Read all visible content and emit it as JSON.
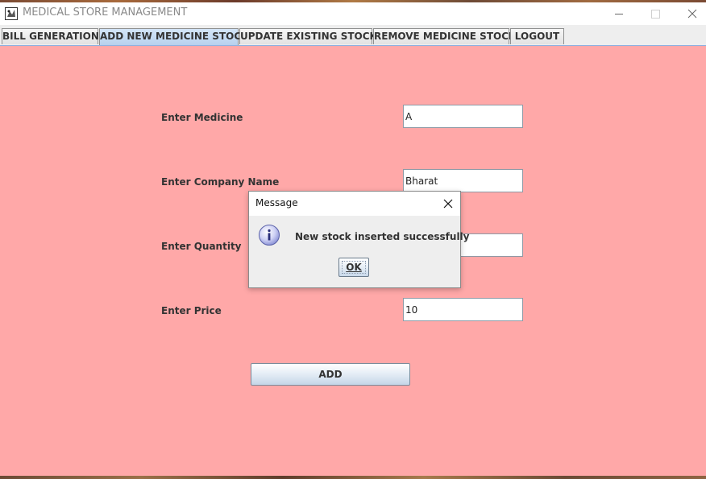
{
  "window": {
    "title": "MEDICAL STORE MANAGEMENT",
    "icon": "app-icon"
  },
  "tabs": [
    {
      "label": "BILL GENERATION",
      "selected": false
    },
    {
      "label": "ADD NEW MEDICINE STOCK",
      "selected": true
    },
    {
      "label": "UPDATE EXISTING STOCK",
      "selected": false
    },
    {
      "label": "REMOVE MEDICINE STOCK",
      "selected": false
    },
    {
      "label": "LOGOUT",
      "selected": false
    }
  ],
  "form": {
    "medicine_label": "Enter Medicine",
    "medicine_value": "A",
    "company_label": "Enter Company Name",
    "company_value": "Bharat",
    "quantity_label": "Enter Quantity",
    "quantity_value": "",
    "price_label": "Enter Price",
    "price_value": "10",
    "add_label": "ADD"
  },
  "dialog": {
    "title": "Message",
    "message": "New stock inserted successfully",
    "ok_label": "OK",
    "icon": "info-icon"
  },
  "colors": {
    "content_background": "#ffa8a8",
    "selected_tab": "#b8d1ee"
  }
}
